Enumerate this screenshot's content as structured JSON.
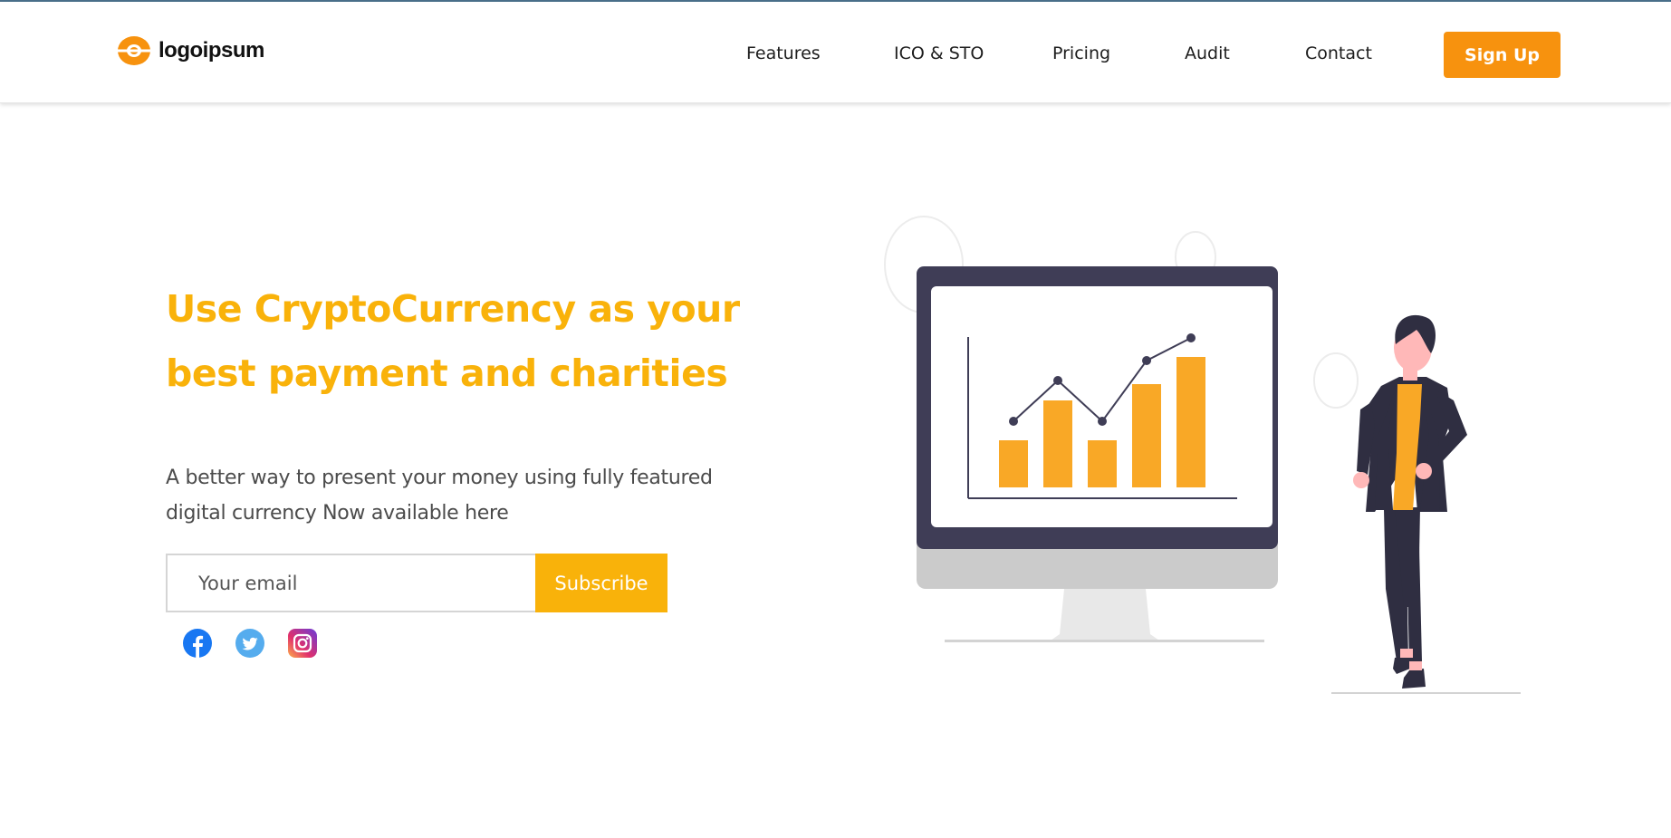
{
  "header": {
    "logo_text": "logoipsum",
    "nav": [
      {
        "label": "Features"
      },
      {
        "label": "ICO & STO"
      },
      {
        "label": "Pricing"
      },
      {
        "label": "Audit"
      },
      {
        "label": "Contact"
      }
    ],
    "signup_label": "Sign Up"
  },
  "hero": {
    "title": "Use CryptoCurrency as your best payment and charities",
    "subtitle": "A better way to present your money using fully featured digital currency Now available here",
    "email_placeholder": "Your email",
    "subscribe_label": "Subscribe"
  },
  "social": [
    "facebook-icon",
    "twitter-icon",
    "instagram-icon"
  ],
  "colors": {
    "accent": "#f9b20a",
    "signup": "#f7920e",
    "chart_bar": "#f9a826",
    "dark": "#3f3d56"
  },
  "illustration": {
    "icon": "monitor-growth-chart-with-person"
  }
}
